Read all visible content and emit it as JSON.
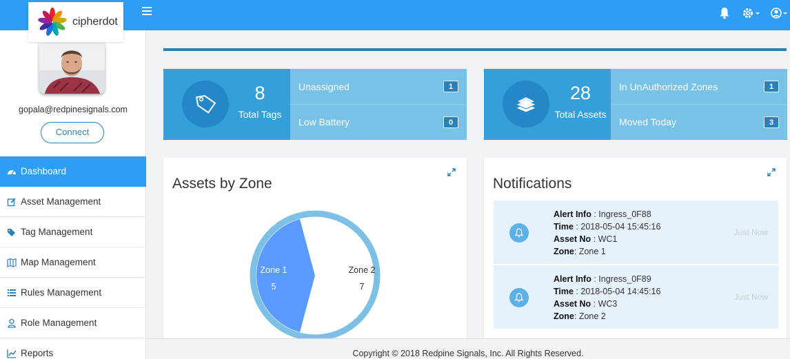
{
  "brand": {
    "name": "cipherdot"
  },
  "user": {
    "email": "gopala@redpinesignals.com",
    "connect_label": "Connect"
  },
  "sidebar": {
    "items": [
      {
        "label": "Dashboard",
        "icon": "dashboard-icon",
        "active": true
      },
      {
        "label": "Asset Management",
        "icon": "edit-icon"
      },
      {
        "label": "Tag Management",
        "icon": "tags-icon"
      },
      {
        "label": "Map Management",
        "icon": "map-icon"
      },
      {
        "label": "Rules Management",
        "icon": "list-icon"
      },
      {
        "label": "Role Management",
        "icon": "user-icon"
      },
      {
        "label": "Reports",
        "icon": "chart-icon"
      }
    ]
  },
  "header": {
    "icons": [
      "menu-icon",
      "bell-icon",
      "gear-icon",
      "user-circle-icon"
    ]
  },
  "tags_card": {
    "count": "8",
    "label": "Total Tags",
    "icon": "tag-icon",
    "rows": [
      {
        "label": "Unassigned",
        "value": "1"
      },
      {
        "label": "Low Battery",
        "value": "0"
      }
    ]
  },
  "assets_card": {
    "count": "28",
    "label": "Total Assets",
    "icon": "assets-stack-icon",
    "rows": [
      {
        "label": "In UnAuthorized Zones",
        "value": "1"
      },
      {
        "label": "Moved Today",
        "value": "3"
      }
    ]
  },
  "zone_panel": {
    "title": "Assets by Zone"
  },
  "chart_data": {
    "type": "pie",
    "title": "Assets by Zone",
    "categories": [
      "Zone 1",
      "Zone 2"
    ],
    "values": [
      5,
      7
    ],
    "colors": [
      "#5b9bff",
      "#ffffff"
    ]
  },
  "notifications": {
    "title": "Notifications",
    "field_labels": {
      "alert": "Alert Info",
      "time": "Time",
      "asset": "Asset No",
      "zone": "Zone"
    },
    "items": [
      {
        "alert": "Ingress_0F88",
        "time": "2018-05-04 15:45:16",
        "asset": "WC1",
        "zone": "Zone 1",
        "when": "Just Now"
      },
      {
        "alert": "Ingress_0F89",
        "time": "2018-05-04 14:45:16",
        "asset": "WC3",
        "zone": "Zone 2",
        "when": "Just Now"
      }
    ]
  },
  "colors": {
    "primary": "#2f9df4",
    "card_dark": "#359fd9",
    "card_light": "#79c2e7",
    "zone1": "#5b9bff"
  },
  "footer": {
    "text": "Copyright © 2018 Redpine Signals, Inc. All Rights Reserved."
  }
}
